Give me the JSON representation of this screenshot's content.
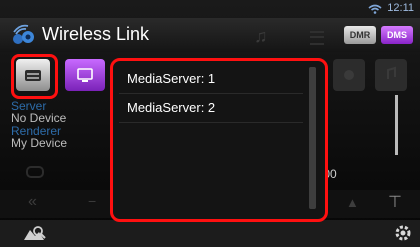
{
  "status": {
    "time": "12:11"
  },
  "header": {
    "title": "Wireless Link",
    "mode_buttons": [
      "DMR",
      "DMS"
    ]
  },
  "panel": {
    "server_label": "Server",
    "server_value": "No Device",
    "renderer_label": "Renderer",
    "renderer_value": "My Device",
    "time_fragment": ":00"
  },
  "popup": {
    "items": [
      "MediaServer: 1",
      "MediaServer: 2"
    ]
  },
  "colors": {
    "highlight": "#ff1010",
    "accent": "#b148f2",
    "label_blue": "#2d6ba8"
  }
}
